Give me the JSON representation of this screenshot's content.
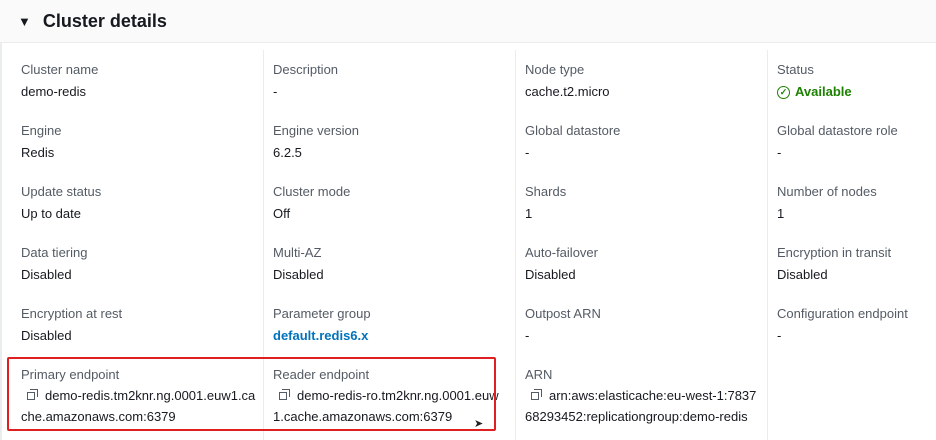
{
  "header": {
    "title": "Cluster details"
  },
  "fields": {
    "cluster_name": {
      "label": "Cluster name",
      "value": "demo-redis"
    },
    "description": {
      "label": "Description",
      "value": "-"
    },
    "node_type": {
      "label": "Node type",
      "value": "cache.t2.micro"
    },
    "status": {
      "label": "Status",
      "value": "Available"
    },
    "engine": {
      "label": "Engine",
      "value": "Redis"
    },
    "engine_version": {
      "label": "Engine version",
      "value": "6.2.5"
    },
    "global_datastore": {
      "label": "Global datastore",
      "value": "-"
    },
    "global_datastore_role": {
      "label": "Global datastore role",
      "value": "-"
    },
    "update_status": {
      "label": "Update status",
      "value": "Up to date"
    },
    "cluster_mode": {
      "label": "Cluster mode",
      "value": "Off"
    },
    "shards": {
      "label": "Shards",
      "value": "1"
    },
    "number_of_nodes": {
      "label": "Number of nodes",
      "value": "1"
    },
    "data_tiering": {
      "label": "Data tiering",
      "value": "Disabled"
    },
    "multi_az": {
      "label": "Multi-AZ",
      "value": "Disabled"
    },
    "auto_failover": {
      "label": "Auto-failover",
      "value": "Disabled"
    },
    "encryption_in_transit": {
      "label": "Encryption in transit",
      "value": "Disabled"
    },
    "encryption_at_rest": {
      "label": "Encryption at rest",
      "value": "Disabled"
    },
    "parameter_group": {
      "label": "Parameter group",
      "value": "default.redis6.x"
    },
    "outpost_arn": {
      "label": "Outpost ARN",
      "value": "-"
    },
    "configuration_endpoint": {
      "label": "Configuration endpoint",
      "value": "-"
    },
    "primary_endpoint": {
      "label": "Primary endpoint",
      "value": "demo-redis.tm2knr.ng.0001.euw1.cache.amazonaws.com:6379"
    },
    "reader_endpoint": {
      "label": "Reader endpoint",
      "value": "demo-redis-ro.tm2knr.ng.0001.euw1.cache.amazonaws.com:6379"
    },
    "arn": {
      "label": "ARN",
      "value": "arn:aws:elasticache:eu-west-1:783768293452:replicationgroup:demo-redis"
    }
  },
  "colors": {
    "status_green": "#1d8102",
    "link_blue": "#0073bb",
    "highlight_red": "#e02020"
  }
}
